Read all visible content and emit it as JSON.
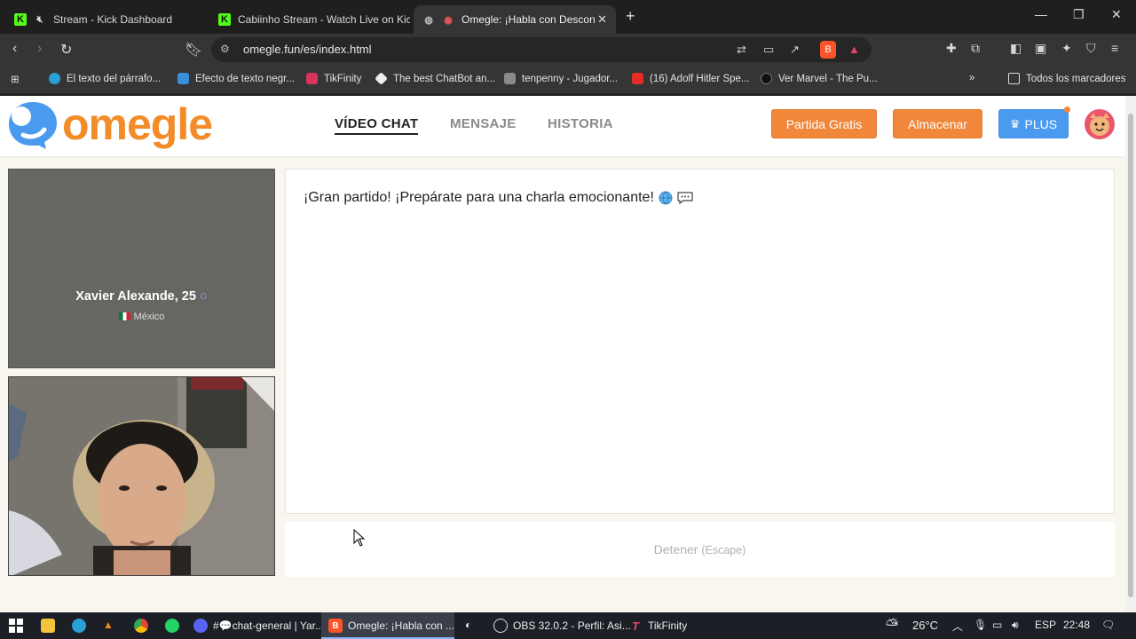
{
  "browser": {
    "tabs": [
      {
        "title": "Stream - Kick Dashboard",
        "active": false
      },
      {
        "title": "Cabiinho Stream - Watch Live on Kick",
        "active": false
      },
      {
        "title": "Omegle: ¡Habla con Descono",
        "active": true
      }
    ],
    "url": "omegle.fun/es/index.html",
    "bookmarks": [
      "El texto del párrafo...",
      "Efecto de texto negr...",
      "TikFinity",
      "The best ChatBot an...",
      "tenpenny - Jugador...",
      "(16) Adolf Hitler Spe...",
      "Ver Marvel - The Pu..."
    ],
    "all_bookmarks_label": "Todos los marcadores"
  },
  "site": {
    "logo_text": "omegle",
    "nav": {
      "video_chat": "VÍDEO CHAT",
      "message": "MENSAJE",
      "history": "HISTORIA"
    },
    "buttons": {
      "free_match": "Partida Gratis",
      "store": "Almacenar",
      "plus": "PLUS"
    },
    "colors": {
      "brand_orange": "#f28c28",
      "brand_blue": "#4a9bf0"
    }
  },
  "stranger": {
    "name": "Xavier Alexande, 25",
    "country": "México"
  },
  "chat": {
    "system_message": "¡Gran partido! ¡Prepárate para una charla emocionante!",
    "stop_label": "Detener",
    "stop_hint": "(Escape)"
  },
  "taskbar": {
    "apps": [
      "#💬chat-general | Yar...",
      "Omegle: ¡Habla con ...",
      "OBS 32.0.2 - Perfil: Asi...",
      "TikFinity"
    ],
    "weather": "26°C",
    "language": "ESP",
    "time": "22:48"
  }
}
